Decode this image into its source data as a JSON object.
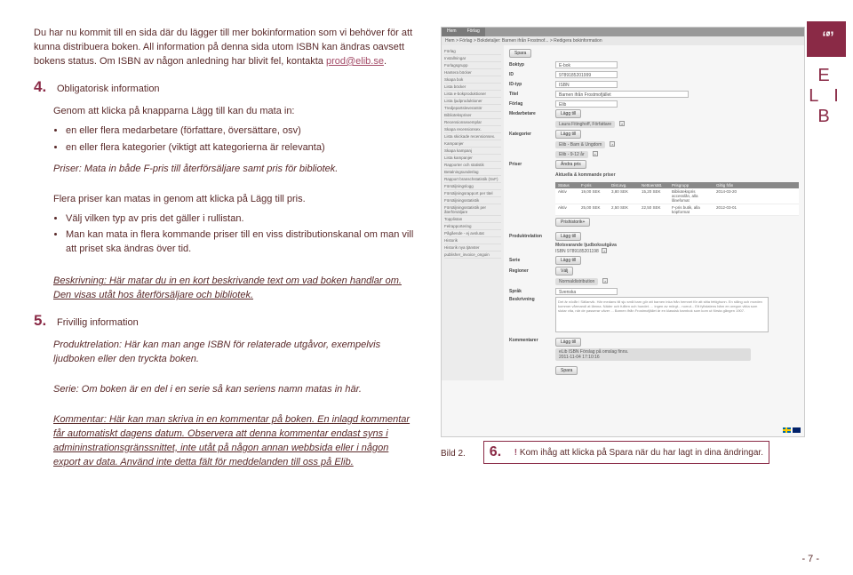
{
  "logo": {
    "quotes": "“ ”",
    "name": "E L I B"
  },
  "intro": {
    "p1": "Du har nu kommit till en sida där du lägger till mer bokinformation som vi behöver för att kunna distribuera boken. All information på denna sida utom ISBN kan ändras oavsett bokens status. Om ISBN av någon anledning har blivit fel, kontakta ",
    "link": "prod@elib.se",
    "p1end": "."
  },
  "sec4": {
    "num": "4.",
    "title": "Obligatorisk information",
    "lead": "Genom att klicka på knapparna Lägg till kan du mata in:",
    "b1": "en eller flera medarbetare (författare, översättare, osv)",
    "b2": "en eller flera kategorier (viktigt att kategorierna är relevanta)",
    "priser_lead": "Priser: Mata in både F-pris till återförsäljare samt pris för bibliotek.",
    "p_flera": "Flera priser kan matas in genom att klicka på Lägg till pris.",
    "bp1": "Välj vilken typ av pris det gäller i rullistan.",
    "bp2": "Man kan mata in flera kommande priser till en viss distributionskanal om man vill att priset ska ändras över tid.",
    "beskr": "Beskrivning: Här matar du in en kort beskrivande text om vad boken handlar om. Den visas utåt hos återförsäljare och bibliotek."
  },
  "sec5": {
    "num": "5.",
    "title": "Frivillig information",
    "pr": "Produktrelation: Här kan man ange ISBN för relaterade utgåvor, exempelvis ljudboken eller den tryckta boken.",
    "serie": "Serie: Om boken är en del i en serie så kan seriens namn matas in här.",
    "komm": "Kommentar: Här kan man skriva in en kommentar på boken. En inlagd kommentar får automatiskt dagens datum. Observera att denna kommentar endast syns i admininstrationsgränssnittet, inte utåt på någon annan webbsida eller i någon export av data. Använd inte detta fält för meddelanden till oss på Elib."
  },
  "screenshot": {
    "tab1": "Hem",
    "tab2": "Förlag",
    "crumb": "Hem > Förlag > Bokdetaljer: Barnen ifrån Frostmof... > Redigera bokinformation",
    "sidebar": [
      "Förlag",
      "Installningar",
      "Forlagsgrupp",
      "Hantera böcker",
      "Skapa bok",
      "Lista böcker",
      "Lista e-bokproduktioner",
      "Lista ljudproduktioner",
      "Tredjepartsleverantör",
      "Bibliotekspriser",
      "Recensionsexemplar",
      "Skapa recensionsex.",
      "Lista skickade recensionsex.",
      "Kampanjer",
      "Skapa kampanj",
      "Lista kampanjer",
      "Rapporter och statistik",
      "Betalningsunderlag",
      "Rapport branschstatistik (SvF)",
      "Försäljningslogg",
      "Försäljningsrapport per titel",
      "Försäljningsstatistik",
      "Försäljningsstatistik per återförsäljare",
      "Topplistan",
      "Felrapportering",
      "Pågående - ej avslutat",
      "Historik",
      "Historik nya tjänster",
      "publisher_invoice_ongoin"
    ],
    "save": "Spara",
    "labels": {
      "boktyp": "Boktyp",
      "id": "ID",
      "idtyp": "ID-typ",
      "titel": "Titel",
      "forlag": "Förlag",
      "medarbetare": "Medarbetare",
      "kategorier": "Kategorier",
      "priser": "Priser",
      "produktrelation": "Produktrelation",
      "serie": "Serie",
      "regioner": "Regioner",
      "sprak": "Språk",
      "beskrivning": "Beskrivning",
      "kommentarer": "Kommentarer"
    },
    "boktyp_val": "E-bok",
    "id_val": "9789185201999",
    "idtyp_val": "ISBN",
    "titel_val": "Barnen ifrån Frostmofjället",
    "forlag_val": "Elib",
    "laggtill": "Lägg till",
    "medarbetare_pill": "Laura Fitinghoff, Författare",
    "kat1": "Elib - Barn & Ungdom",
    "kat2": "Elib - 9-12 år",
    "andra_pris": "Ändra pris",
    "aktuella": "Aktuella & kommande priser",
    "th": [
      "Status",
      "F-pris",
      "Dist.avg.",
      "Nettoersätt.",
      "Prisgrupp",
      "Giltig från"
    ],
    "tr1": [
      "Aktiv",
      "19,00 SEK",
      "3,80 SEK",
      "15,20 SEK",
      "Bibliotekspris accesslån, alla lånefomat",
      "2014-03-20"
    ],
    "tr2": [
      "Aktiv",
      "25,00 SEK",
      "2,50 SEK",
      "22,50 SEK",
      "F-pris butik, alla köpformat",
      "2012-03-01"
    ],
    "prishistorik": "Prishistorik+",
    "motsv": "Motsvarande ljudboksutgåva",
    "motsv_isbn": "ISBN 9789185201198",
    "valj": "Välj",
    "region_val": "Normaldistribution",
    "sprak_val": "Svenska",
    "beskr_text": "Det är nödår i Sällanvik. Här medans till sju små barn gör att barnen inka från hemnet för att sitta fettighunn. En stång och morden kommer vårmandi at lämna. Näder och fullten och hundet. ... ingen av mörgt... norrut... Ett fyllstatens bärn en oregon vikta som slutar vita, när de passerar väver ... Barnen ifrån Frostmofjället är en klassisk barnbok som kom ut första gången 1907.",
    "komm_1": "eLib ISBN Förslag på omslag finns.",
    "komm_date": "2011-11-04 17:10:16"
  },
  "bild2": "Bild 2.",
  "sec6": {
    "num": "6.",
    "excl": "!",
    "text": "Kom ihåg att klicka på Spara när du har lagt in dina ändringar."
  },
  "page_num": "- 7 -"
}
